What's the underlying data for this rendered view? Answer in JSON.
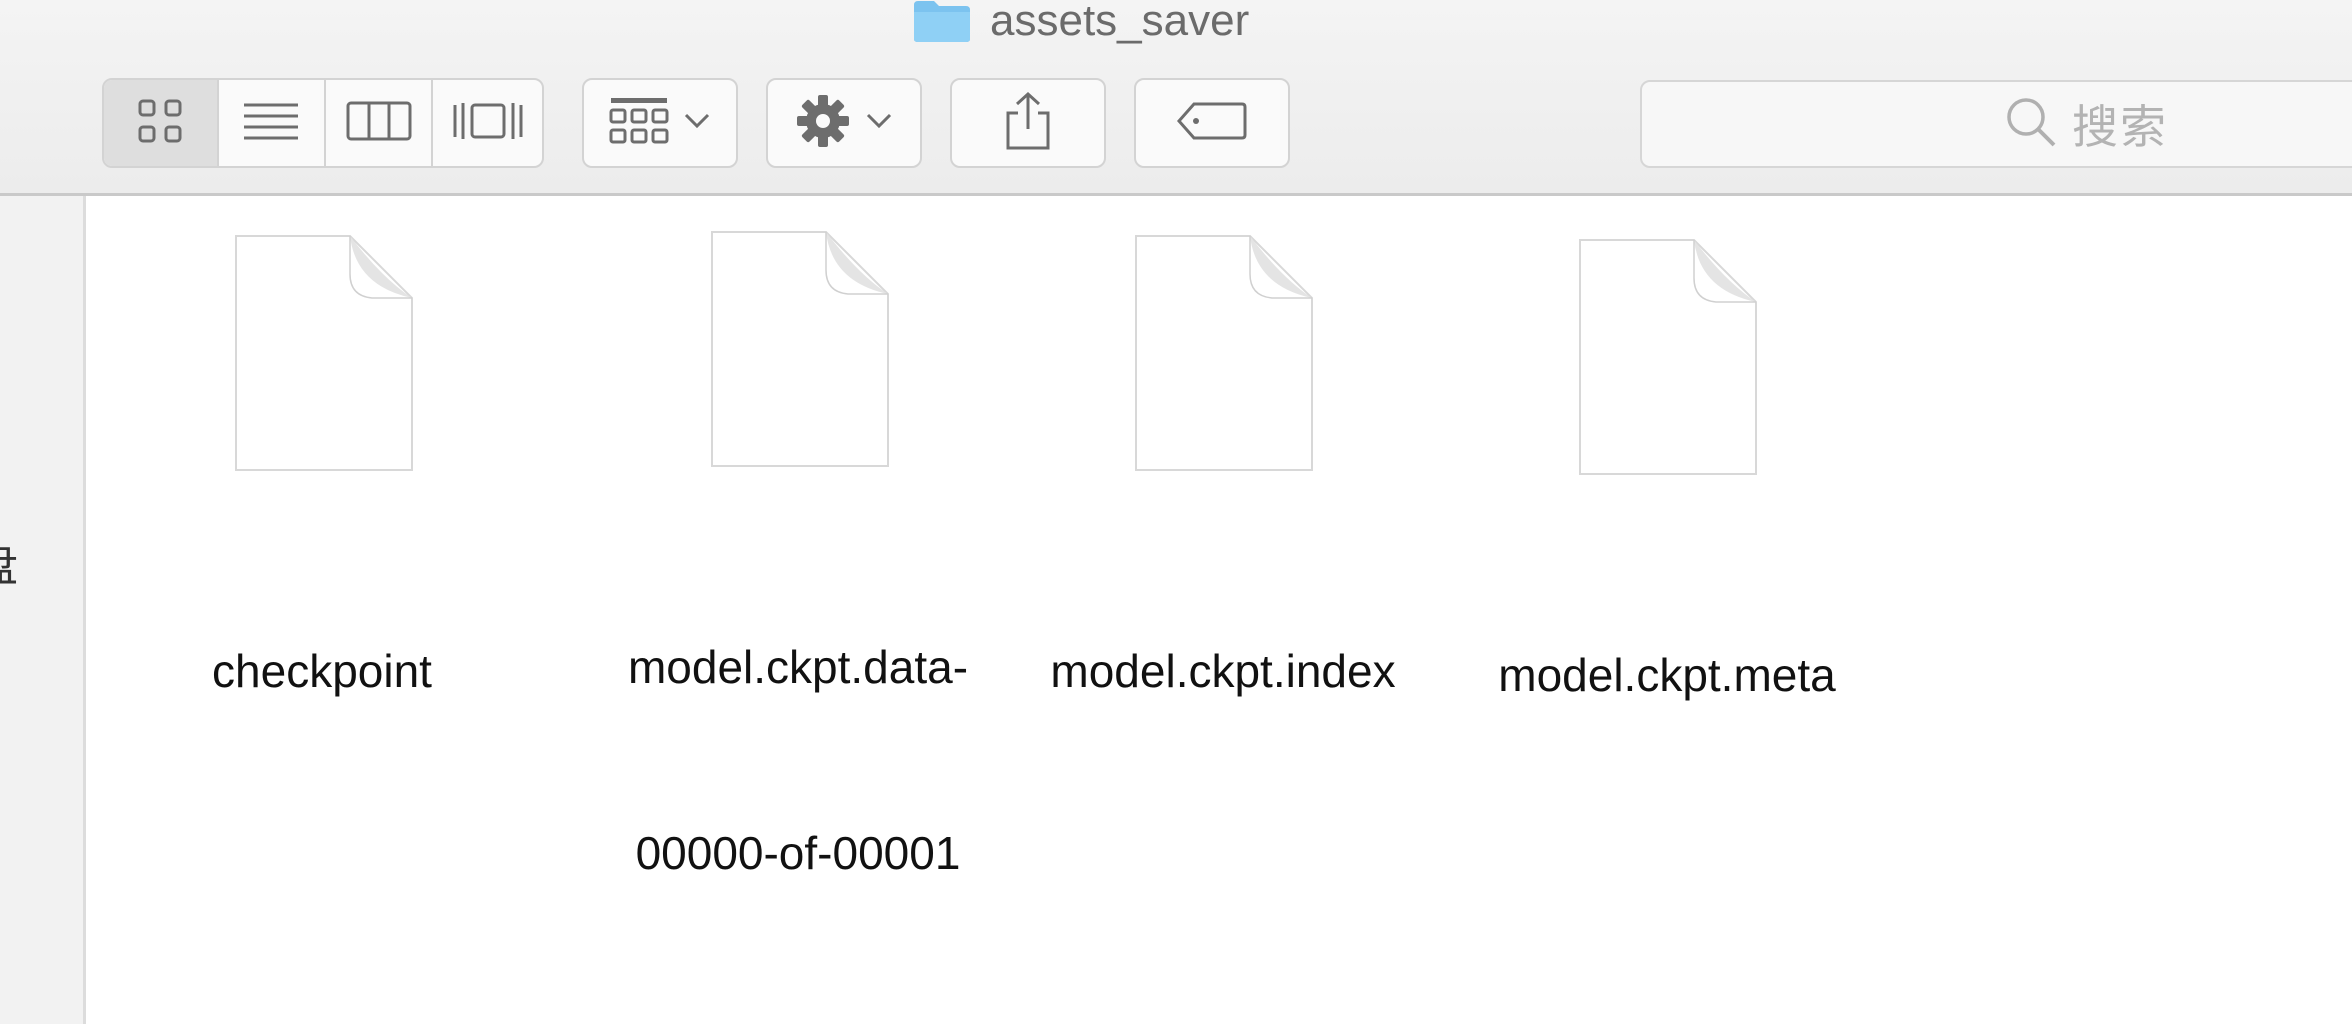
{
  "window": {
    "title": "assets_saver"
  },
  "toolbar": {
    "view_buttons": [
      {
        "icon": "icon-view-icon",
        "active": true
      },
      {
        "icon": "list-view-icon",
        "active": false
      },
      {
        "icon": "column-view-icon",
        "active": false
      },
      {
        "icon": "cover-flow-view-icon",
        "active": false
      }
    ],
    "arrange_icon": "group-arrange-icon",
    "action_icon": "gear-icon",
    "share_icon": "share-icon",
    "tag_icon": "tag-icon"
  },
  "search": {
    "placeholder": "搜索",
    "icon": "search-icon"
  },
  "sidebar": {
    "visible_fragment": "盘"
  },
  "files": [
    {
      "name_lines": [
        "checkpoint"
      ],
      "icon": "document-icon"
    },
    {
      "name_lines": [
        "model.ckpt.data-",
        "00000-of-00001"
      ],
      "icon": "document-icon"
    },
    {
      "name_lines": [
        "model.ckpt.index"
      ],
      "icon": "document-icon"
    },
    {
      "name_lines": [
        "model.ckpt.meta"
      ],
      "icon": "document-icon"
    }
  ],
  "colors": {
    "folder_blue": "#7cc3ef",
    "toolbar_bg": "#ececec",
    "icon_gray": "#6d6d6d"
  }
}
